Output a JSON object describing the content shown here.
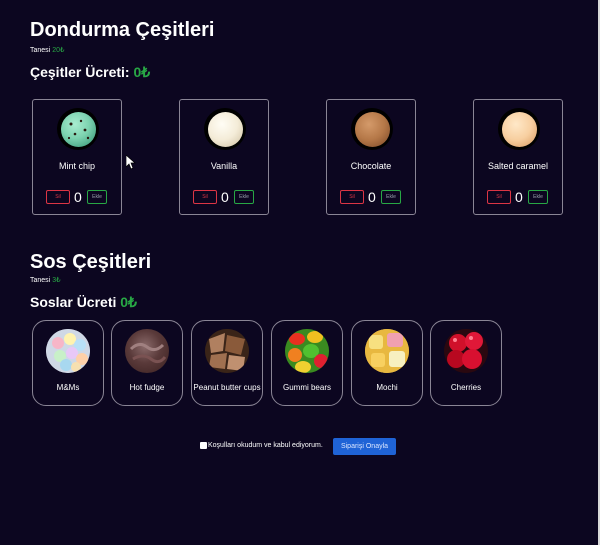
{
  "ice_cream": {
    "title": "Dondurma Çeşitleri",
    "unit_label": "Tanesi ",
    "unit_price": "20₺",
    "total_label": "Çeşitler Ücreti: ",
    "total_value": "0₺",
    "items": [
      {
        "label": "Mint chip",
        "qty": "0",
        "remove_label": "Sil",
        "add_label": "Ekle"
      },
      {
        "label": "Vanilla",
        "qty": "0",
        "remove_label": "Sil",
        "add_label": "Ekle"
      },
      {
        "label": "Chocolate",
        "qty": "0",
        "remove_label": "Sil",
        "add_label": "Ekle"
      },
      {
        "label": "Salted caramel",
        "qty": "0",
        "remove_label": "Sil",
        "add_label": "Ekle"
      }
    ]
  },
  "sauces": {
    "title": "Sos Çeşitleri",
    "unit_label": "Tanesi ",
    "unit_price": "3₺",
    "total_label": "Soslar Ücreti ",
    "total_value": "0₺",
    "items": [
      {
        "label": "M&Ms"
      },
      {
        "label": "Hot fudge"
      },
      {
        "label": "Peanut butter cups"
      },
      {
        "label": "Gummi bears"
      },
      {
        "label": "Mochi"
      },
      {
        "label": "Cherries"
      }
    ]
  },
  "confirm": {
    "terms_label": "Koşulları okudum ve kabul ediyorum.",
    "button_label": "Siparişi Onayla"
  },
  "colors": {
    "background": "#0c0620",
    "accent_green": "#28a745",
    "danger_red": "#dc3545",
    "primary_blue": "#1f63d6"
  }
}
